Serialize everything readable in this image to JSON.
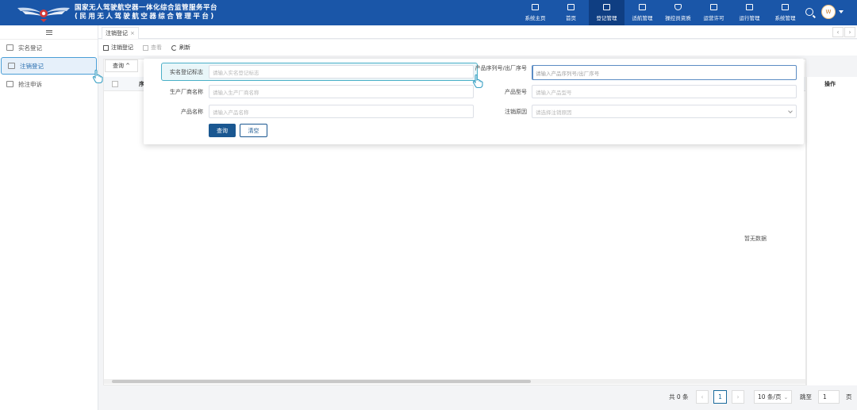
{
  "header": {
    "title_line1": "国家无人驾驶航空器一体化综合监管服务平台",
    "title_line2": "(民用无人驾驶航空器综合管理平台)",
    "nav": [
      {
        "label": "系统主页",
        "icon": "home-screen-icon"
      },
      {
        "label": "首页",
        "icon": "monitor-icon"
      },
      {
        "label": "登记管理",
        "icon": "document-icon",
        "active": true
      },
      {
        "label": "适航管理",
        "icon": "drone-icon"
      },
      {
        "label": "操控员资质",
        "icon": "shield-icon"
      },
      {
        "label": "运营许可",
        "icon": "play-screen-icon"
      },
      {
        "label": "运行管理",
        "icon": "clipboard-icon"
      },
      {
        "label": "系统管理",
        "icon": "settings-grid-icon"
      }
    ],
    "avatar_letter": "W"
  },
  "sidebar": {
    "items": [
      {
        "label": "实名登记"
      },
      {
        "label": "注销登记",
        "active": true
      },
      {
        "label": "抢注申诉"
      }
    ]
  },
  "tabs": {
    "active_tab": "注销登记",
    "close": "×",
    "prev": "‹",
    "next": "›"
  },
  "toolbar": {
    "cancel_registration": "注销登记",
    "view": "查看",
    "refresh": "刷新"
  },
  "query_toggle": "查询 ^",
  "form": {
    "fields": [
      {
        "label": "实名登记标志",
        "placeholder": "请输入实名登记标志"
      },
      {
        "label": "产品序列号/出厂序号",
        "placeholder": "请输入产品序列号/出厂序号"
      },
      {
        "label": "生产厂商名称",
        "placeholder": "请输入生产厂商名称"
      },
      {
        "label": "产品型号",
        "placeholder": "请输入产品型号"
      },
      {
        "label": "产品名称",
        "placeholder": "请输入产品名称"
      },
      {
        "label": "注销原因",
        "placeholder": "请选择注销原因"
      }
    ],
    "search_button": "查询",
    "clear_button": "清空"
  },
  "table": {
    "seq_header": "序",
    "operation_header": "操作",
    "empty_text": "暂无数据"
  },
  "pagination": {
    "total": "共 0 条",
    "current_page": "1",
    "page_size": "10 条/页",
    "goto_label": "跳至",
    "goto_value": "1",
    "page_unit": "页"
  },
  "colors": {
    "header_bg": "#1a56a8",
    "primary": "#1a5791",
    "highlight": "#4ab0c8"
  }
}
